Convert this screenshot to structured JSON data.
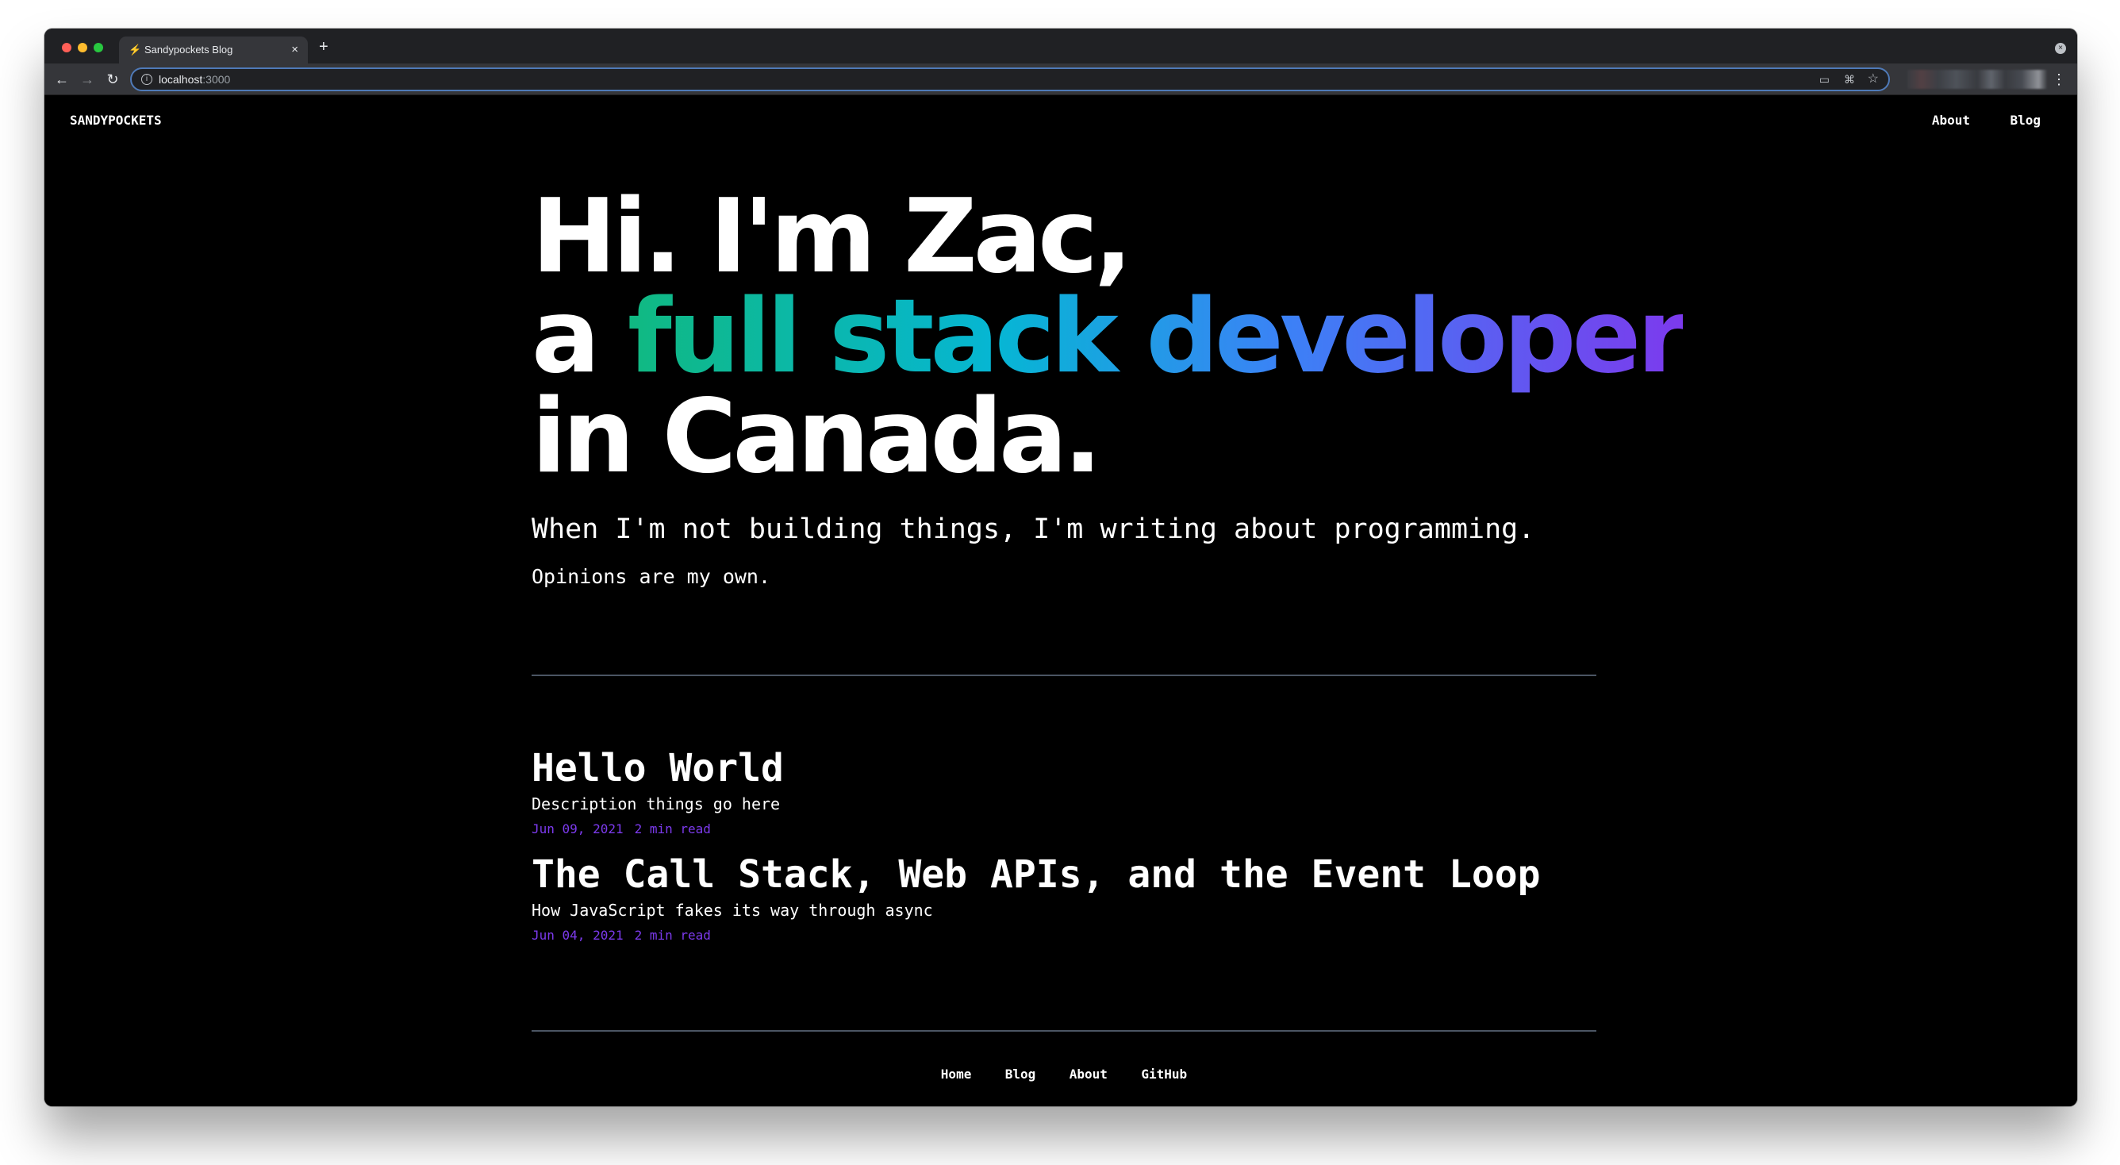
{
  "browser": {
    "tab_favicon": "⚡",
    "tab_title": "Sandypockets Blog",
    "tab_close": "×",
    "new_tab": "+",
    "url_host": "localhost",
    "url_port": ":3000",
    "icons": [
      "back-arrow-icon",
      "forward-arrow-icon",
      "reload-icon",
      "info-icon",
      "cast-icon",
      "extension-icon",
      "star-icon",
      "kebab-menu-icon"
    ]
  },
  "header": {
    "logo": "SANDYPOCKETS",
    "nav": [
      "About",
      "Blog"
    ]
  },
  "hero": {
    "line1": "Hi. I'm Zac,",
    "line2_prefix": "a ",
    "line2_highlight": "full stack developer",
    "line3": "in Canada.",
    "subtitle": "When I'm not building things, I'm writing about programming.",
    "note": "Opinions are my own.",
    "gradient_colors": [
      "#10b981",
      "#06b6d4",
      "#3b82f6",
      "#7c3aed"
    ]
  },
  "posts": [
    {
      "title": "Hello World",
      "description": "Description things go here",
      "date": "Jun 09, 2021",
      "read_time": "2 min read"
    },
    {
      "title": "The Call Stack, Web APIs, and the Event Loop",
      "description": "How JavaScript fakes its way through async",
      "date": "Jun 04, 2021",
      "read_time": "2 min read"
    }
  ],
  "footer": {
    "links": [
      "Home",
      "Blog",
      "About",
      "GitHub"
    ]
  },
  "colors": {
    "background": "#000000",
    "text": "#ffffff",
    "meta_accent": "#7c3aed"
  }
}
